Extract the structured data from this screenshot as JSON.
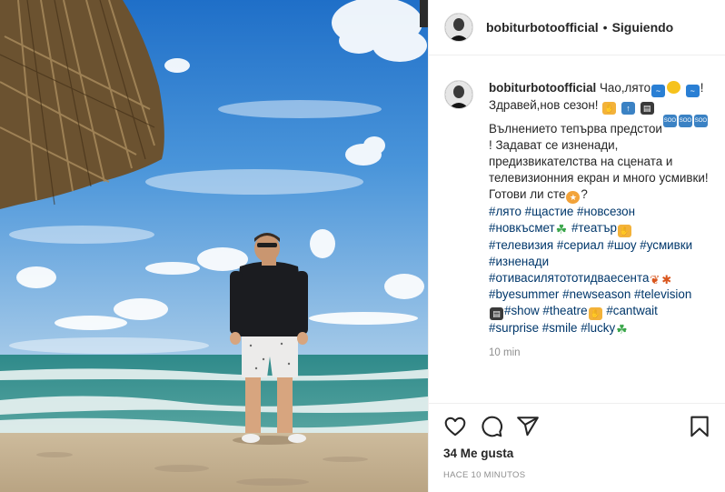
{
  "header": {
    "username": "bobiturbotoofficial",
    "dot": "•",
    "follow_status": "Siguiendo"
  },
  "caption": {
    "username": "bobiturbotoofficial",
    "t1": "Чао,лято",
    "t2": "! Здравей,нов сезон!",
    "t3": "Вълнението тепърва предстои",
    "t4": "! Задават се изненади, предизвикателства на сцената и телевизионния екран и много усмивки! Готови ли сте",
    "t5": "?",
    "tags1": "#лято #щастие #новсезон",
    "tags2": "#новкъсмет",
    "tags3": "#театър",
    "tags4": "#телевизия #сериал #шоу #усмивки",
    "tags5": "#изненади",
    "tags6": "#отивасилятототидваесента",
    "tags7": "#byesummer #newseason #television",
    "tags8": "#show #theatre",
    "tags9": "#cantwait",
    "tags10": "#surprise #smile #lucky",
    "time": "10 min",
    "soon": "SOON",
    "top": "TOP"
  },
  "icons": {
    "like": "heart-icon",
    "comment": "comment-icon",
    "share": "share-icon",
    "save": "bookmark-icon"
  },
  "likes": "34 Me gusta",
  "posted": "HACE 10 MINUTOS",
  "colors": {
    "text": "#262626",
    "muted": "#8e8e8e",
    "hashtag": "#00376b",
    "border": "#efefef"
  }
}
